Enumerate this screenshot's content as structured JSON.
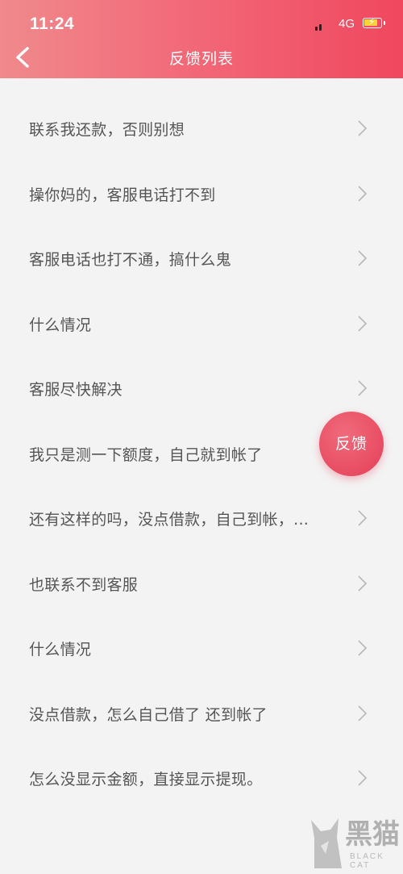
{
  "status_bar": {
    "time": "11:24",
    "network": "4G"
  },
  "header": {
    "title": "反馈列表"
  },
  "feedback_items": [
    {
      "label": "联系我还款，否则别想"
    },
    {
      "label": "操你妈的，客服电话打不到"
    },
    {
      "label": "客服电话也打不通，搞什么鬼"
    },
    {
      "label": "什么情况"
    },
    {
      "label": "客服尽快解决"
    },
    {
      "label": "我只是测一下额度，自己就到帐了"
    },
    {
      "label": "还有这样的吗，没点借款，自己到帐，..."
    },
    {
      "label": "也联系不到客服"
    },
    {
      "label": "什么情况"
    },
    {
      "label": "没点借款，怎么自己借了 还到帐了"
    },
    {
      "label": "怎么没显示金额，直接显示提现。"
    }
  ],
  "fab": {
    "label": "反馈"
  },
  "watermark": {
    "brand": "黑猫",
    "brand_en": "BLACK CAT"
  },
  "colors": {
    "header_start": "#f08a8c",
    "header_end": "#f0475e",
    "fab": "#e84c62",
    "background": "#f3f3f3",
    "text": "#555555"
  }
}
